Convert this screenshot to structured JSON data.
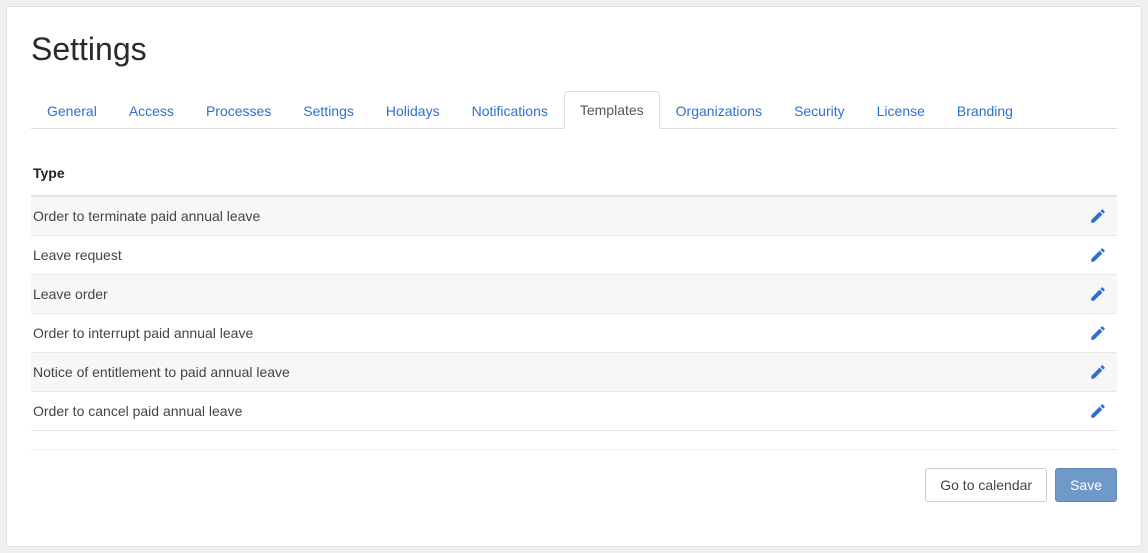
{
  "page": {
    "title": "Settings"
  },
  "tabs": [
    {
      "label": "General",
      "active": false
    },
    {
      "label": "Access",
      "active": false
    },
    {
      "label": "Processes",
      "active": false
    },
    {
      "label": "Settings",
      "active": false
    },
    {
      "label": "Holidays",
      "active": false
    },
    {
      "label": "Notifications",
      "active": false
    },
    {
      "label": "Templates",
      "active": true
    },
    {
      "label": "Organizations",
      "active": false
    },
    {
      "label": "Security",
      "active": false
    },
    {
      "label": "License",
      "active": false
    },
    {
      "label": "Branding",
      "active": false
    }
  ],
  "table": {
    "header": "Type",
    "rows": [
      {
        "label": "Order to terminate paid annual leave"
      },
      {
        "label": "Leave request"
      },
      {
        "label": "Leave order"
      },
      {
        "label": "Order to interrupt paid annual leave"
      },
      {
        "label": "Notice of entitlement to paid annual leave"
      },
      {
        "label": "Order to cancel paid annual leave"
      }
    ]
  },
  "footer": {
    "go_to_calendar": "Go to calendar",
    "save": "Save"
  }
}
